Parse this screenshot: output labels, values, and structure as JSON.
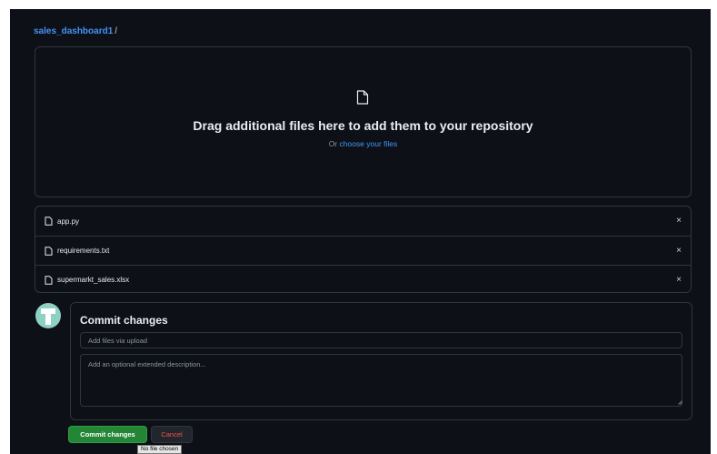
{
  "breadcrumb": {
    "repo": "sales_dashboard1",
    "separator": "/"
  },
  "dropzone": {
    "icon": "file-icon",
    "title": "Drag additional files here to add them to your repository",
    "prefix": "Or ",
    "link": "choose your files"
  },
  "files": [
    {
      "name": "app.py",
      "icon": "file-icon",
      "remove": "×"
    },
    {
      "name": "requirements.txt",
      "icon": "file-icon",
      "remove": "×"
    },
    {
      "name": "supermarkt_sales.xlsx",
      "icon": "file-icon",
      "remove": "×"
    }
  ],
  "commit": {
    "title": "Commit changes",
    "summary_placeholder": "Add files via upload",
    "description_placeholder": "Add an optional extended description..."
  },
  "actions": {
    "commit": "Commit changes",
    "cancel": "Cancel"
  },
  "tooltip": "No file chosen",
  "colors": {
    "background": "#0d1117",
    "border": "#30363d",
    "link": "#4493f8",
    "primary_button": "#238636",
    "danger_text": "#f85149",
    "muted_text": "#8b949e"
  }
}
